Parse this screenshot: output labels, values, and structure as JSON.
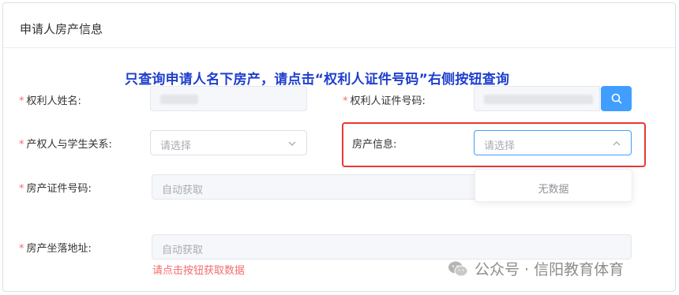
{
  "panel": {
    "title": "申请人房产信息"
  },
  "notice": "只查询申请人名下房产，请点击“权利人证件号码”右侧按钮查询",
  "fields": {
    "owner_name": {
      "label": "权利人姓名:"
    },
    "owner_id": {
      "label": "权利人证件号码:",
      "search_icon": "search-icon"
    },
    "relation": {
      "label": "产权人与学生关系:",
      "placeholder": "请选择"
    },
    "house_info": {
      "label": "房产信息:",
      "placeholder": "请选择",
      "empty_text": "无数据"
    },
    "cert_no": {
      "label": "房产证件号码:",
      "placeholder": "自动获取"
    },
    "address": {
      "label": "房产坐落地址:",
      "placeholder": "自动获取",
      "hint": "请点击按钮获取数据"
    }
  },
  "required_mark": "*",
  "watermark": {
    "text": "公众号 · 信阳教育体育",
    "icon": "wechat-icon"
  },
  "colors": {
    "accent": "#409eff",
    "notice": "#1f3fcf",
    "error": "#f56c6c",
    "highlight_frame": "#e53935"
  }
}
